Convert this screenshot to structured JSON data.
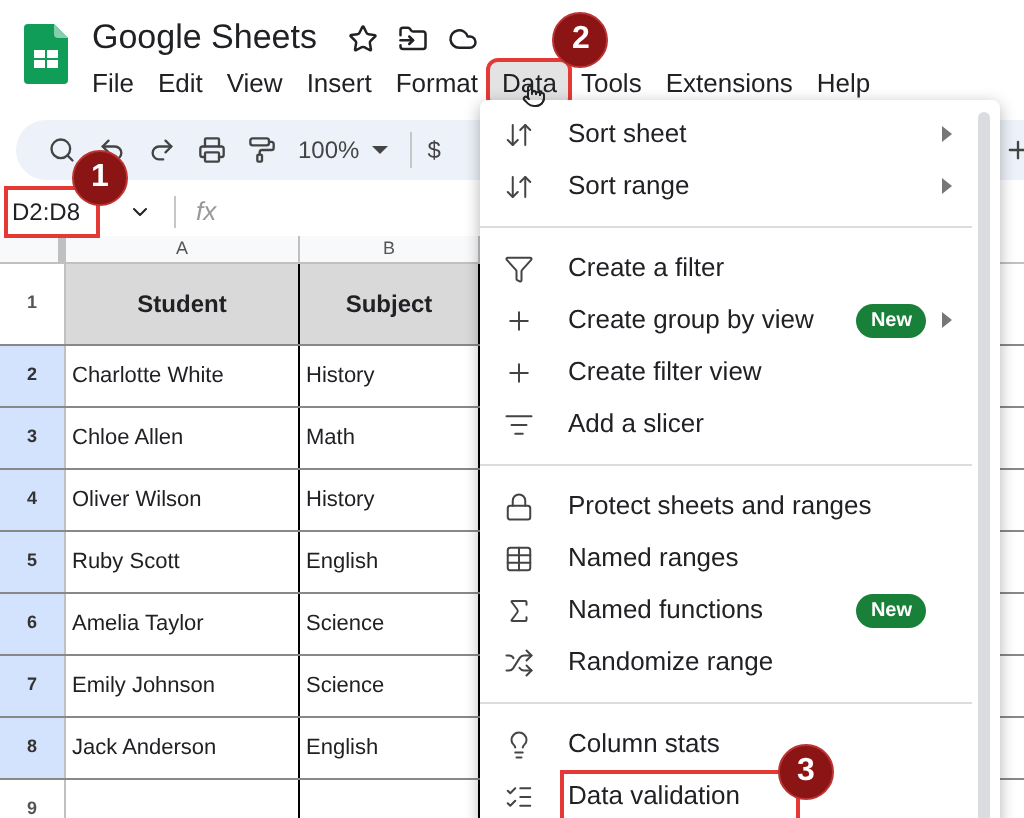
{
  "app": {
    "title": "Google Sheets"
  },
  "menu_bar": [
    {
      "label": "File",
      "selected": false
    },
    {
      "label": "Edit",
      "selected": false
    },
    {
      "label": "View",
      "selected": false
    },
    {
      "label": "Insert",
      "selected": false
    },
    {
      "label": "Format",
      "selected": false
    },
    {
      "label": "Data",
      "selected": true,
      "highlighted": true,
      "callout": "2"
    },
    {
      "label": "Tools",
      "selected": false
    },
    {
      "label": "Extensions",
      "selected": false
    },
    {
      "label": "Help",
      "selected": false
    }
  ],
  "toolbar": {
    "zoom": "100%",
    "currency": "$"
  },
  "name_box": {
    "value": "D2:D8",
    "highlighted": true,
    "callout": "1"
  },
  "formula_bar": {
    "label": "fx"
  },
  "columns": [
    "A",
    "B"
  ],
  "rows": [
    {
      "number": "1",
      "selected": false,
      "header": true,
      "cells": [
        "Student",
        "Subject"
      ]
    },
    {
      "number": "2",
      "selected": true,
      "cells": [
        "Charlotte White",
        "History"
      ]
    },
    {
      "number": "3",
      "selected": true,
      "cells": [
        "Chloe Allen",
        "Math"
      ]
    },
    {
      "number": "4",
      "selected": true,
      "cells": [
        "Oliver Wilson",
        "History"
      ]
    },
    {
      "number": "5",
      "selected": true,
      "cells": [
        "Ruby Scott",
        "English"
      ]
    },
    {
      "number": "6",
      "selected": true,
      "cells": [
        "Amelia Taylor",
        "Science"
      ]
    },
    {
      "number": "7",
      "selected": true,
      "cells": [
        "Emily Johnson",
        "Science"
      ]
    },
    {
      "number": "8",
      "selected": true,
      "cells": [
        "Jack Anderson",
        "English"
      ]
    },
    {
      "number": "9",
      "selected": false,
      "cells": []
    }
  ],
  "data_menu": {
    "sections": [
      {
        "items": [
          {
            "label": "Sort sheet",
            "submenu": true
          },
          {
            "label": "Sort range",
            "submenu": true
          }
        ]
      },
      {
        "items": [
          {
            "label": "Create a filter"
          },
          {
            "label": "Create group by view",
            "badge": "New",
            "submenu": true
          },
          {
            "label": "Create filter view"
          },
          {
            "label": "Add a slicer"
          }
        ]
      },
      {
        "items": [
          {
            "label": "Protect sheets and ranges"
          },
          {
            "label": "Named ranges"
          },
          {
            "label": "Named functions",
            "badge": "New"
          },
          {
            "label": "Randomize range"
          }
        ]
      },
      {
        "items": [
          {
            "label": "Column stats"
          },
          {
            "label": "Data validation",
            "highlighted": true,
            "callout": "3"
          }
        ]
      }
    ]
  }
}
